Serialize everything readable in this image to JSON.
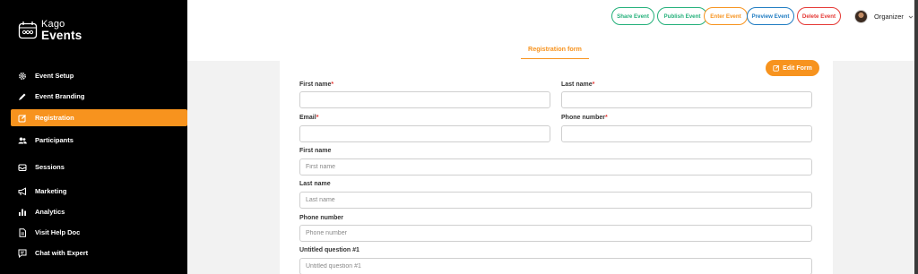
{
  "brand": {
    "line1": "Kago",
    "line2": "Events"
  },
  "sidebar": {
    "items": [
      {
        "label": "Event Setup",
        "icon": "gear-icon",
        "active": false
      },
      {
        "label": "Event Branding",
        "icon": "pen-icon",
        "active": false
      },
      {
        "label": "Registration",
        "icon": "edit-square-icon",
        "active": true
      },
      {
        "label": "Participants",
        "icon": "users-icon",
        "active": false
      },
      {
        "label": "Sessions",
        "icon": "inbox-icon",
        "active": false
      },
      {
        "label": "Marketing",
        "icon": "megaphone-icon",
        "active": false
      },
      {
        "label": "Analytics",
        "icon": "bar-chart-icon",
        "active": false
      },
      {
        "label": "Visit Help Doc",
        "icon": "document-icon",
        "active": false
      },
      {
        "label": "Chat with Expert",
        "icon": "chat-icon",
        "active": false
      }
    ]
  },
  "toolbar": {
    "share": "Share Event",
    "publish": "Publish Event",
    "enter": "Enter Event",
    "preview": "Preview Event",
    "delete": "Delete Event"
  },
  "profile": {
    "name": "Organizer"
  },
  "tabs": {
    "registration_form": "Registration form"
  },
  "edit_form_label": "Edit Form",
  "form": {
    "first_name_label": "First name",
    "last_name_label": "Last name",
    "email_label": "Email",
    "phone_label": "Phone number",
    "required_mark": "*",
    "custom_fields": [
      {
        "label": "First name",
        "placeholder": "First name"
      },
      {
        "label": "Last name",
        "placeholder": "Last name"
      },
      {
        "label": "Phone number",
        "placeholder": "Phone number"
      },
      {
        "label": "Untitled question #1",
        "placeholder": "Untitled question #1"
      }
    ]
  },
  "colors": {
    "accent": "#f7931e",
    "sidebar_bg": "#000000",
    "share": "#23b07a",
    "preview": "#1f7cc2",
    "delete": "#e53935"
  }
}
